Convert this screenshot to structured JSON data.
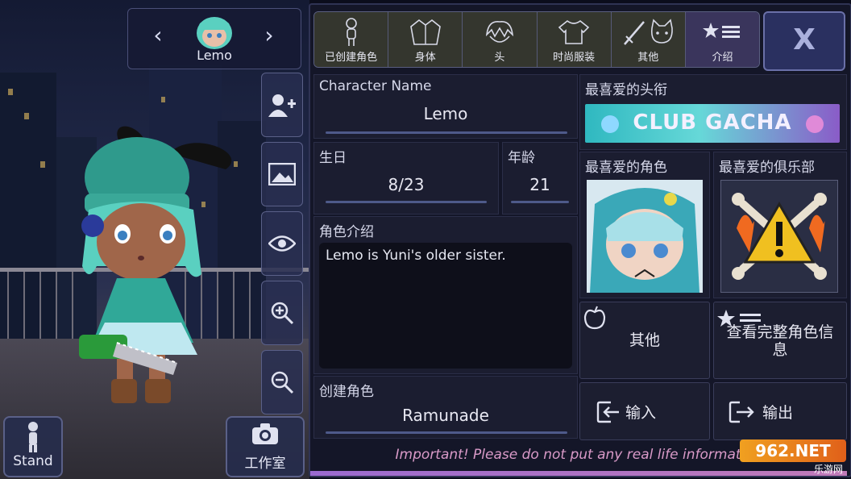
{
  "character": {
    "name": "Lemo"
  },
  "left_buttons": {
    "stand": "Stand",
    "studio": "工作室"
  },
  "tabs": [
    {
      "label": "已创建角色",
      "icon": "person-icon"
    },
    {
      "label": "身体",
      "icon": "jacket-icon"
    },
    {
      "label": "头",
      "icon": "hair-icon"
    },
    {
      "label": "时尚服装",
      "icon": "shirt-icon"
    },
    {
      "label": "其他",
      "icon": "sword-cat-icon"
    },
    {
      "label": "介绍",
      "icon": "star-list-icon"
    }
  ],
  "close_label": "X",
  "profile": {
    "name_header": "Character Name",
    "name_value": "Lemo",
    "birthday_header": "生日",
    "birthday_value": "8/23",
    "age_header": "年龄",
    "age_value": "21",
    "bio_header": "角色介绍",
    "bio_value": "Lemo is Yuni's older sister.",
    "creator_header": "创建角色",
    "creator_value": "Ramunade"
  },
  "favorites": {
    "title_header": "最喜爱的头衔",
    "title_banner": "CLUB GACHA",
    "character_header": "最喜爱的角色",
    "club_header": "最喜爱的俱乐部"
  },
  "actions": {
    "other": "其他",
    "view_full": "查看完整角色信息",
    "import": "输入",
    "export": "输出"
  },
  "notice": "Important! Please do not put any real life information",
  "watermark": {
    "main": "962.NET",
    "sub": "乐游网"
  },
  "colors": {
    "accent": "#3a355c",
    "notice": "#d99ac8",
    "banner": "#3cc6c8"
  }
}
